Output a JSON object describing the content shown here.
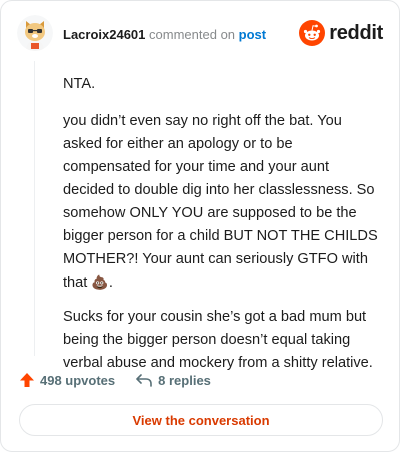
{
  "header": {
    "username": "Lacroix24601",
    "action_text": "commented on",
    "post_link": "post",
    "brand": "reddit"
  },
  "comment": {
    "paragraphs": [
      "NTA.",
      "you didn’t even say no right off the bat. You asked for either an apology or to be compensated for your time and your aunt decided to double dig into her classlessness. So somehow ONLY YOU are supposed to be the bigger person for a child BUT NOT THE CHILDS MOTHER?! Your aunt can seriously GTFO with that",
      "Sucks for your cousin she’s got a bad mum but being the bigger person doesn’t equal taking verbal abuse and mockery from a shitty relative."
    ],
    "emoji": "💩"
  },
  "actions": {
    "upvotes": "498 upvotes",
    "replies": "8 replies"
  },
  "footer": {
    "button_label": "View the conversation"
  },
  "icons": {
    "upvote": "upvote-arrow-icon",
    "reply": "reply-arrow-icon",
    "brand": "reddit-snoo-icon",
    "avatar": "user-avatar"
  },
  "colors": {
    "upvote": "#ff4500",
    "link": "#0079d3",
    "brand_orange": "#ff4500",
    "button_text": "#d93a00"
  }
}
